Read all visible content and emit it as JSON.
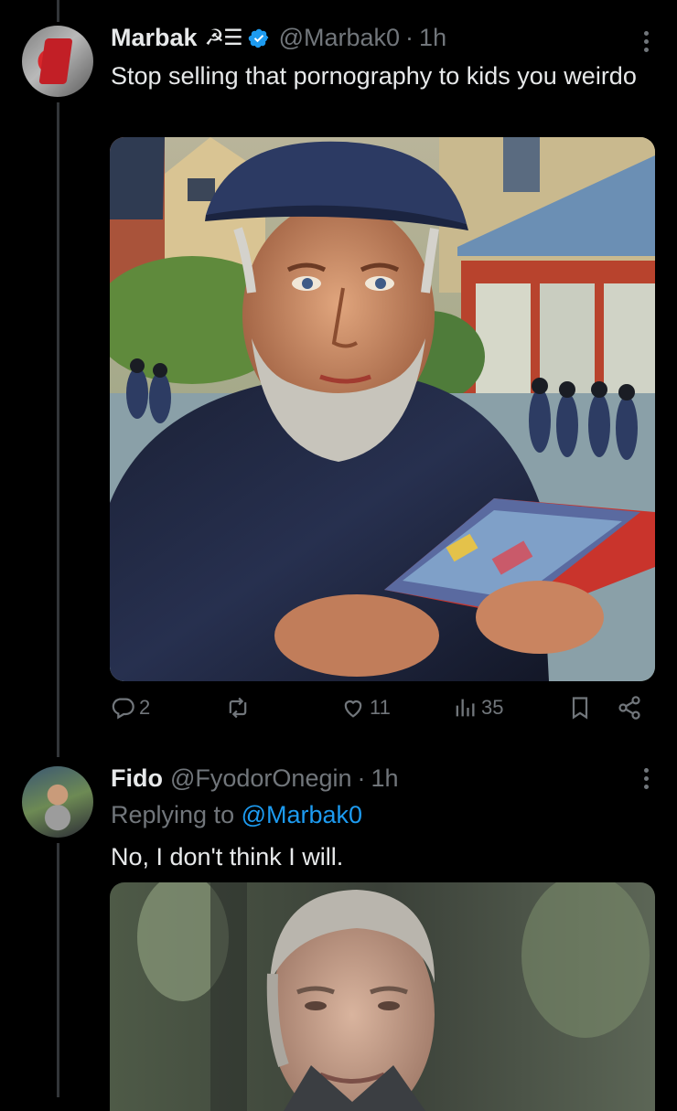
{
  "post": {
    "author_name": "Marbak",
    "name_glyphs": "☭☰",
    "handle": "@Marbak0",
    "separator": "·",
    "time": "1h",
    "text": "Stop selling that pornography to kids you weirdo",
    "media_description": "painting",
    "stats": {
      "replies": "2",
      "reposts": "",
      "likes": "11",
      "views": "35"
    }
  },
  "reply": {
    "author_name": "Fido",
    "handle": "@FyodorOnegin",
    "separator": "·",
    "time": "1h",
    "replying_prefix": "Replying to",
    "replying_to": "@Marbak0",
    "text": "No, I don't think I will."
  },
  "colors": {
    "background": "#000000",
    "text": "#e7e9ea",
    "muted": "#71767b",
    "accent": "#1d9bf0",
    "line": "#333639"
  }
}
